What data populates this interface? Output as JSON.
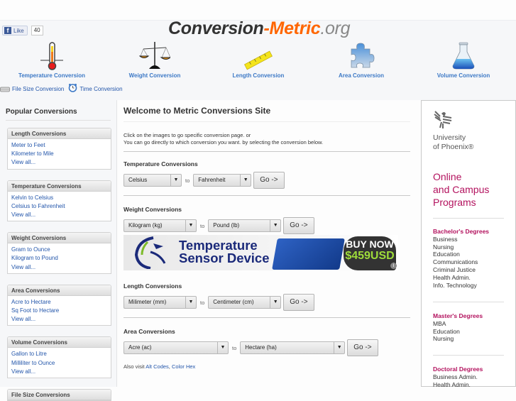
{
  "header": {
    "facebook": {
      "like_label": "Like",
      "count": "40"
    },
    "logo": {
      "part1": "Conversion",
      "part2": "-Metric",
      "part3": ".org"
    },
    "categories": [
      {
        "label": "Temperature Conversion",
        "icon": "thermometer-icon"
      },
      {
        "label": "Weight Conversion",
        "icon": "scale-icon"
      },
      {
        "label": "Length Conversion",
        "icon": "ruler-icon"
      },
      {
        "label": "Area Conversion",
        "icon": "puzzle-icon"
      },
      {
        "label": "Volume Conversion",
        "icon": "flask-icon"
      }
    ],
    "small_links": [
      {
        "label": "File Size Conversion",
        "icon": "hard-drive-icon"
      },
      {
        "label": "Time Conversion",
        "icon": "alarm-clock-icon"
      }
    ]
  },
  "sidebar": {
    "title": "Popular Conversions",
    "boxes": [
      {
        "title": "Length Conversions",
        "links": [
          "Meter to Feet",
          "Kilometer to Mile",
          "View all..."
        ]
      },
      {
        "title": "Temperature Conversions",
        "links": [
          "Kelvin to Celsius",
          "Celsius to Fahrenheit",
          "View all..."
        ]
      },
      {
        "title": "Weight Conversions",
        "links": [
          "Gram to Ounce",
          "Kilogram to Pound",
          "View all..."
        ]
      },
      {
        "title": "Area Conversions",
        "links": [
          "Acre to Hectare",
          "Sq Foot to Hectare",
          "View all..."
        ]
      },
      {
        "title": "Volume Conversions",
        "links": [
          "Gallon to Litre",
          "Milliliter to Ounce",
          "View all..."
        ]
      },
      {
        "title": "File Size Conversions",
        "links": []
      }
    ]
  },
  "main": {
    "title": "Welcome to Metric Conversions Site",
    "intro_line1": "Click on the images to go specific conversion page. or",
    "intro_line2": "You can go directly to which conversion you want. by selecting the conversion below.",
    "to_label": "to",
    "go_label": "Go ->",
    "sections": [
      {
        "title": "Temperature Conversions",
        "from": "Celsius",
        "to": "Fahrenheit"
      },
      {
        "title": "Weight Conversions",
        "from": "Kilogram (kg)",
        "to": "Pound (lb)"
      },
      {
        "title": "Length Conversions",
        "from": "Milimeter (mm)",
        "to": "Centimeter (cm)"
      },
      {
        "title": "Area Conversions",
        "from": "Acre (ac)",
        "to": "Hectare (ha)"
      }
    ],
    "ad": {
      "line1": "Temperature",
      "line2": "Sensor Device",
      "buy": "BUY NOW",
      "price": "$459USD"
    },
    "also_visit": "Also visit",
    "also_links": [
      "Alt Codes",
      "Color Hex"
    ]
  },
  "right_ad": {
    "university": [
      "University",
      "of Phoenix®"
    ],
    "programs": [
      "Online",
      "and Campus",
      "Programs"
    ],
    "degrees": [
      {
        "title": "Bachelor's Degrees",
        "items": [
          "Business",
          "Nursing",
          "Education",
          "Communications",
          "Criminal Justice",
          "Health Admin.",
          "Info. Technology"
        ]
      },
      {
        "title": "Master's Degrees",
        "items": [
          "MBA",
          "Education",
          "Nursing"
        ]
      },
      {
        "title": "Doctoral Degrees",
        "items": [
          "Business Admin.",
          "Health Admin."
        ]
      }
    ]
  },
  "colors": {
    "brand_orange": "#ff6600",
    "link_blue": "#3d79c6",
    "uop_magenta": "#b3125e"
  }
}
